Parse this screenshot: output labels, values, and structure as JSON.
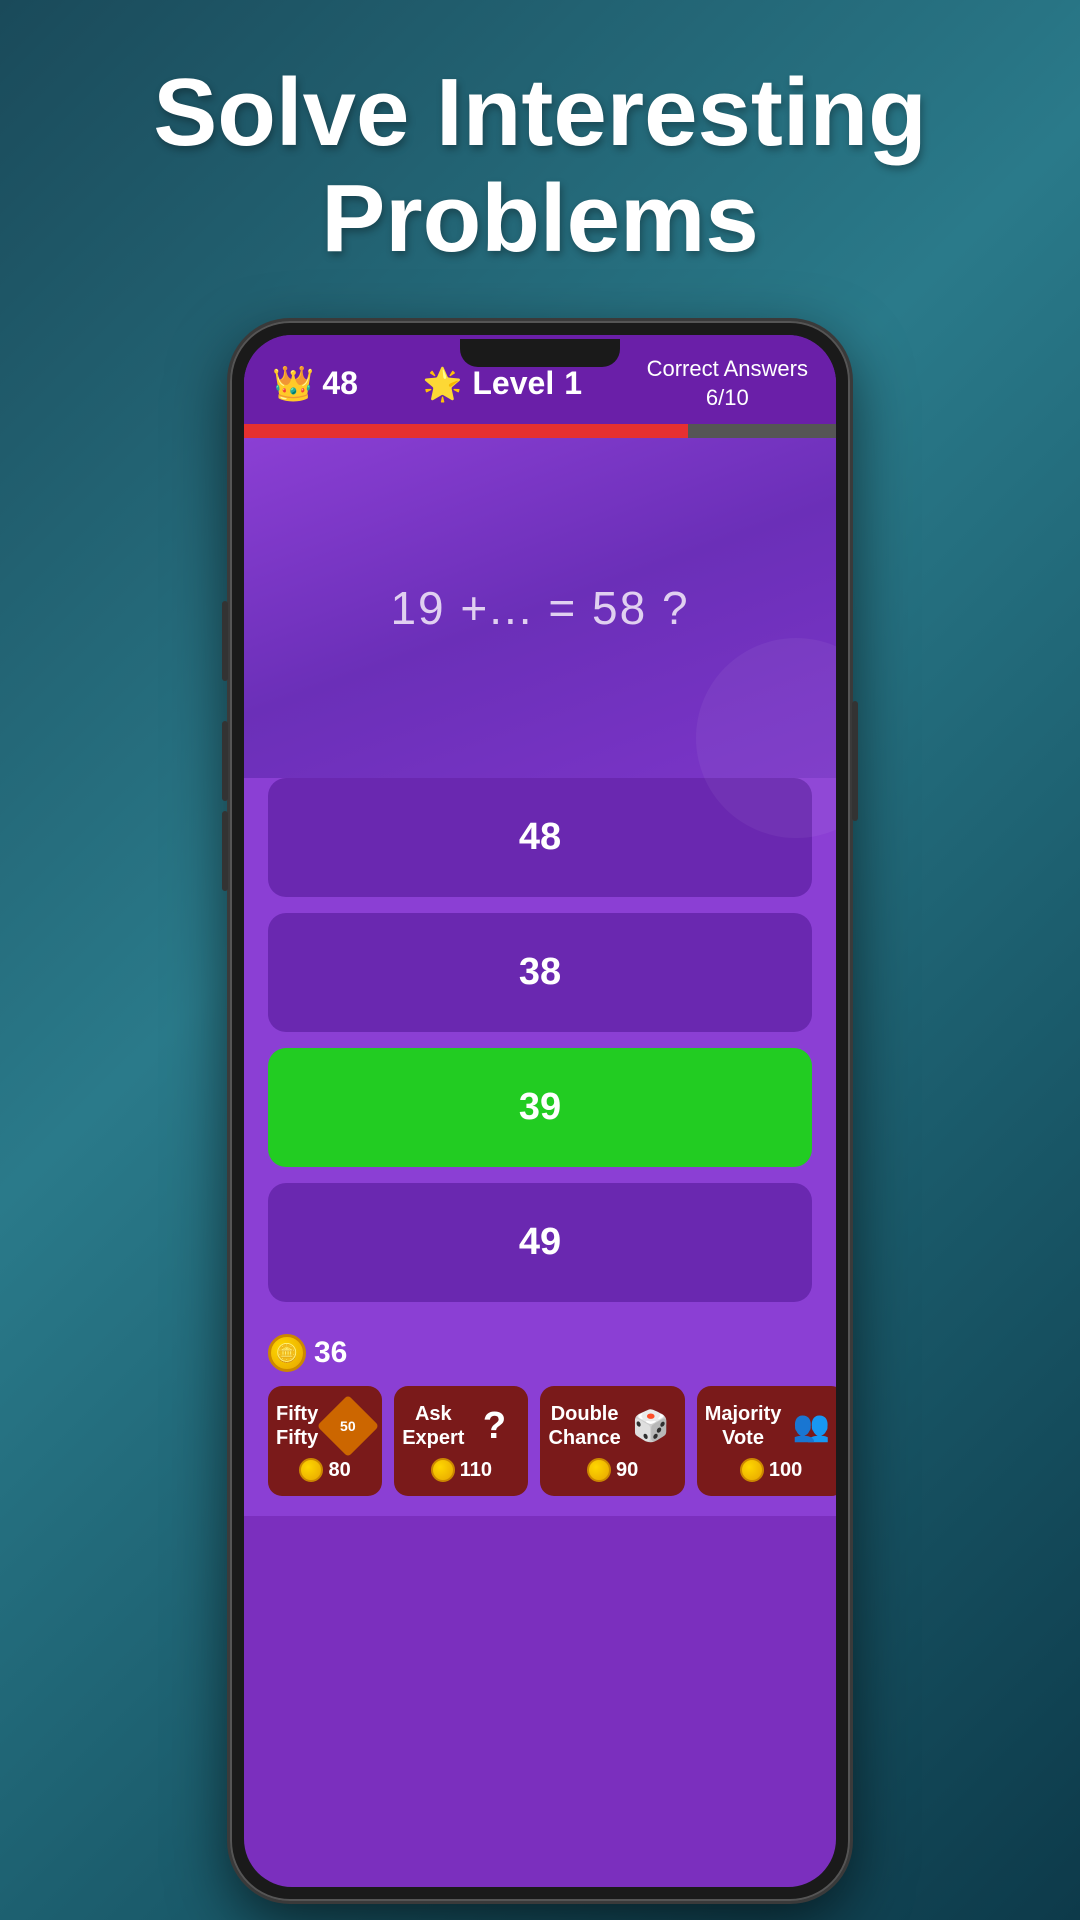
{
  "page": {
    "title_line1": "Solve Interesting",
    "title_line2": "Problems"
  },
  "game": {
    "coins": "48",
    "crown_icon": "👑",
    "level_icon": "🌟",
    "level_label": "Level",
    "level_number": "1",
    "correct_answers_label": "Correct Answers",
    "correct_answers_value": "6/10",
    "progress_percent": "75",
    "question": "19 +... = 58 ?",
    "bottom_coins": "36",
    "answers": [
      {
        "value": "48",
        "style": "purple"
      },
      {
        "value": "38",
        "style": "purple"
      },
      {
        "value": "39",
        "style": "green"
      },
      {
        "value": "49",
        "style": "purple"
      }
    ],
    "lifelines": [
      {
        "name": "Fifty Fifty",
        "cost": "80",
        "icon_type": "diamond"
      },
      {
        "name": "Ask Expert",
        "cost": "110",
        "icon_type": "question"
      },
      {
        "name": "Double Chance",
        "cost": "90",
        "icon_type": "dice"
      },
      {
        "name": "Majority Vote",
        "cost": "100",
        "icon_type": "people"
      }
    ]
  }
}
